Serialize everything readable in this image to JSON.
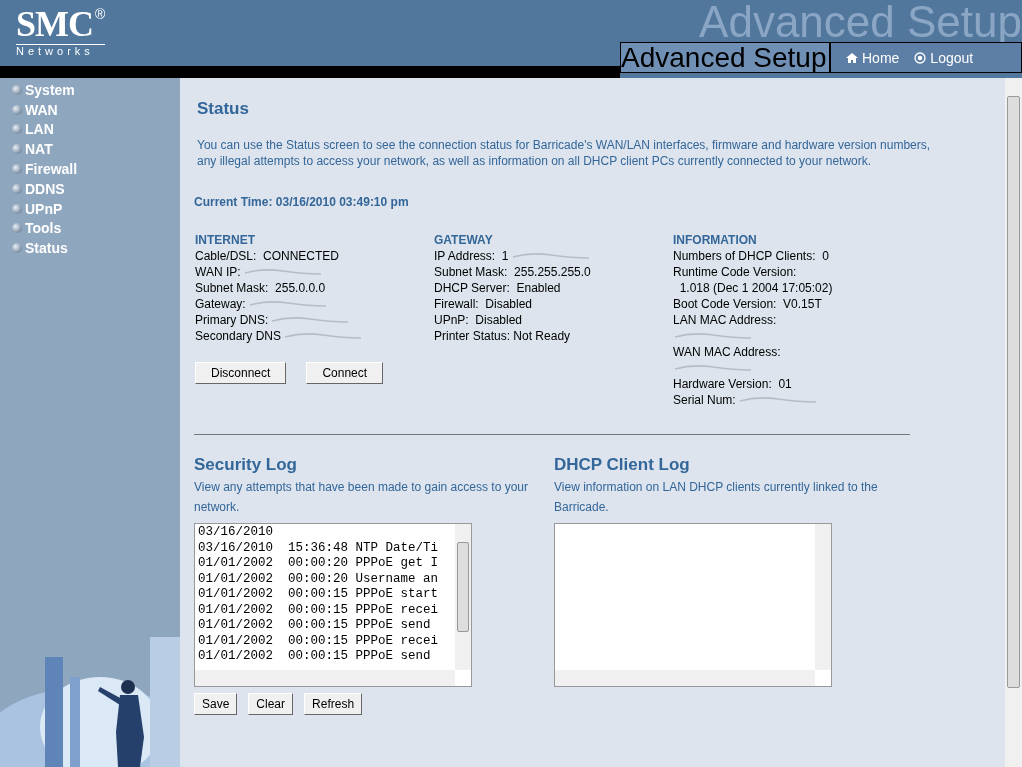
{
  "header": {
    "logo": "SMC",
    "logo_mark": "®",
    "logo_sub": "Networks",
    "banner_title": "Advanced Setup",
    "page_title": "Advanced Setup",
    "links": [
      {
        "label": "Home",
        "kind": "home"
      },
      {
        "label": "Logout",
        "kind": "logout"
      }
    ]
  },
  "sidebar": {
    "items": [
      {
        "label": "System"
      },
      {
        "label": "WAN"
      },
      {
        "label": "LAN"
      },
      {
        "label": "NAT"
      },
      {
        "label": "Firewall"
      },
      {
        "label": "DDNS"
      },
      {
        "label": "UPnP"
      },
      {
        "label": "Tools"
      },
      {
        "label": "Status"
      }
    ]
  },
  "status": {
    "heading": "Status",
    "intro": "You can use the Status screen to see the connection status for Barricade's WAN/LAN interfaces, firmware and hardware version numbers, any illegal attempts to access your network, as well as information on all DHCP client PCs currently connected to your network.",
    "current_time": "Current Time: 03/16/2010 03:49:10 pm",
    "columns": [
      {
        "heading": "INTERNET",
        "lines": [
          {
            "text": "Cable/DSL:  CONNECTED",
            "redacted": false
          },
          {
            "text": "WAN IP:",
            "redacted": true
          },
          {
            "text": "Subnet Mask:  255.0.0.0",
            "redacted": false
          },
          {
            "text": "Gateway:",
            "redacted": true
          },
          {
            "text": "Primary DNS:",
            "redacted": true
          },
          {
            "text": "Secondary DNS",
            "redacted": true
          }
        ],
        "buttons": [
          "Disconnect",
          "Connect"
        ]
      },
      {
        "heading": "GATEWAY",
        "lines": [
          {
            "text": "IP Address:  1",
            "redacted": true
          },
          {
            "text": "Subnet Mask:  255.255.255.0",
            "redacted": false
          },
          {
            "text": "DHCP Server:  Enabled",
            "redacted": false
          },
          {
            "text": "Firewall:  Disabled",
            "redacted": false
          },
          {
            "text": "UPnP:  Disabled",
            "redacted": false
          },
          {
            "text": "Printer Status: Not Ready",
            "redacted": false
          }
        ]
      },
      {
        "heading": "INFORMATION",
        "lines": [
          {
            "text": "Numbers of DHCP Clients:  0",
            "redacted": false
          },
          {
            "text": "Runtime Code Version:",
            "redacted": false
          },
          {
            "text": "  1.018 (Dec 1 2004 17:05:02)",
            "redacted": false
          },
          {
            "text": "Boot Code Version:  V0.15T",
            "redacted": false
          },
          {
            "text": "LAN MAC Address:",
            "redacted": false
          },
          {
            "redacted": true
          },
          {
            "text": "WAN MAC Address:",
            "redacted": false
          },
          {
            "redacted": true
          },
          {
            "text": "Hardware Version:  01",
            "redacted": false
          },
          {
            "text": "Serial Num:",
            "redacted": true
          }
        ]
      }
    ]
  },
  "security_log": {
    "heading": "Security Log",
    "description": "View any attempts that have been made to gain access to your network.",
    "entries": [
      "03/16/2010",
      "03/16/2010  15:36:48 NTP Date/Ti",
      "01/01/2002  00:00:20 PPPoE get I",
      "01/01/2002  00:00:20 Username an",
      "01/01/2002  00:00:15 PPPoE start",
      "01/01/2002  00:00:15 PPPoE recei",
      "01/01/2002  00:00:15 PPPoE send",
      "01/01/2002  00:00:15 PPPoE recei",
      "01/01/2002  00:00:15 PPPoE send"
    ],
    "buttons": [
      "Save",
      "Clear",
      "Refresh"
    ]
  },
  "dhcp_log": {
    "heading": "DHCP Client Log",
    "description": "View information on LAN DHCP clients currently linked to the Barricade."
  }
}
